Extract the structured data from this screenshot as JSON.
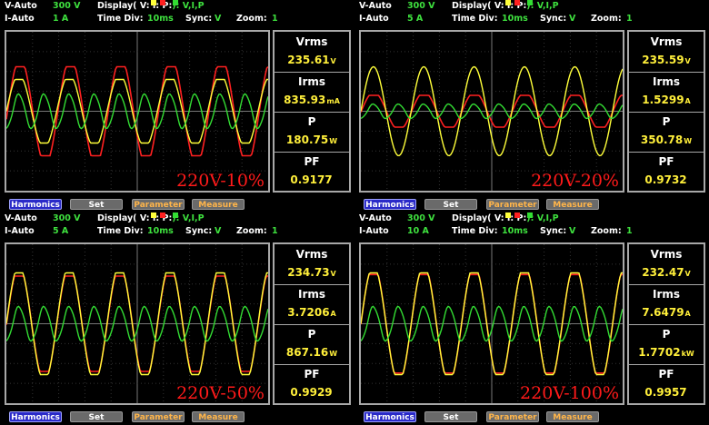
{
  "panels": [
    {
      "v_mode": "V-Auto",
      "v_range": "300 V",
      "i_mode": "I-Auto",
      "i_range": "1 A",
      "display_label": "Display( V:",
      "i_label": "I:",
      "p_label": "P:",
      "display_items": "): V,I,P",
      "timediv_label": "Time Div:",
      "timediv": "10ms",
      "sync_label": "Sync:",
      "sync": "V",
      "zoom_label": "Zoom:",
      "zoom": "1",
      "caption": "220V-10%",
      "measurements": [
        {
          "label": "Vrms",
          "value": "235.61",
          "unit": "V"
        },
        {
          "label": "Irms",
          "value": "835.93",
          "unit": "mA"
        },
        {
          "label": "P",
          "value": "180.75",
          "unit": "W"
        },
        {
          "label": "PF",
          "value": "0.9177",
          "unit": ""
        }
      ],
      "buttons": [
        "Harmonics",
        "Set",
        "Parameter",
        "Measure"
      ]
    },
    {
      "v_mode": "V-Auto",
      "v_range": "300 V",
      "i_mode": "I-Auto",
      "i_range": "5 A",
      "display_label": "Display( V:",
      "i_label": "I:",
      "p_label": "P:",
      "display_items": "): V,I,P",
      "timediv_label": "Time Div:",
      "timediv": "10ms",
      "sync_label": "Sync:",
      "sync": "V",
      "zoom_label": "Zoom:",
      "zoom": "1",
      "caption": "220V-20%",
      "measurements": [
        {
          "label": "Vrms",
          "value": "235.59",
          "unit": "V"
        },
        {
          "label": "Irms",
          "value": "1.5299",
          "unit": "A"
        },
        {
          "label": "P",
          "value": "350.78",
          "unit": "W"
        },
        {
          "label": "PF",
          "value": "0.9732",
          "unit": ""
        }
      ],
      "buttons": [
        "Harmonics",
        "Set",
        "Parameter",
        "Measure"
      ]
    },
    {
      "v_mode": "V-Auto",
      "v_range": "300 V",
      "i_mode": "I-Auto",
      "i_range": "5 A",
      "display_label": "Display( V:",
      "i_label": "I:",
      "p_label": "P:",
      "display_items": "): V,I,P",
      "timediv_label": "Time Div:",
      "timediv": "10ms",
      "sync_label": "Sync:",
      "sync": "V",
      "zoom_label": "Zoom:",
      "zoom": "1",
      "caption": "220V-50%",
      "measurements": [
        {
          "label": "Vrms",
          "value": "234.73",
          "unit": "V"
        },
        {
          "label": "Irms",
          "value": "3.7206",
          "unit": "A"
        },
        {
          "label": "P",
          "value": "867.16",
          "unit": "W"
        },
        {
          "label": "PF",
          "value": "0.9929",
          "unit": ""
        }
      ],
      "buttons": [
        "Harmonics",
        "Set",
        "Parameter",
        "Measure"
      ]
    },
    {
      "v_mode": "V-Auto",
      "v_range": "300 V",
      "i_mode": "I-Auto",
      "i_range": "10 A",
      "display_label": "Display( V:",
      "i_label": "I:",
      "p_label": "P:",
      "display_items": "): V,I,P",
      "timediv_label": "Time Div:",
      "timediv": "10ms",
      "sync_label": "Sync:",
      "sync": "V",
      "zoom_label": "Zoom:",
      "zoom": "1",
      "caption": "220V-100%",
      "measurements": [
        {
          "label": "Vrms",
          "value": "232.47",
          "unit": "V"
        },
        {
          "label": "Irms",
          "value": "7.6479",
          "unit": "A"
        },
        {
          "label": "P",
          "value": "1.7702",
          "unit": "kW"
        },
        {
          "label": "PF",
          "value": "0.9957",
          "unit": ""
        }
      ],
      "buttons": [
        "Harmonics",
        "Set",
        "Parameter",
        "Measure"
      ]
    }
  ],
  "colors": {
    "voltage": "#ffff3a",
    "current": "#ff2020",
    "power": "#33dd33",
    "caption": "#ff1a1a",
    "value": "#ffef3a"
  }
}
